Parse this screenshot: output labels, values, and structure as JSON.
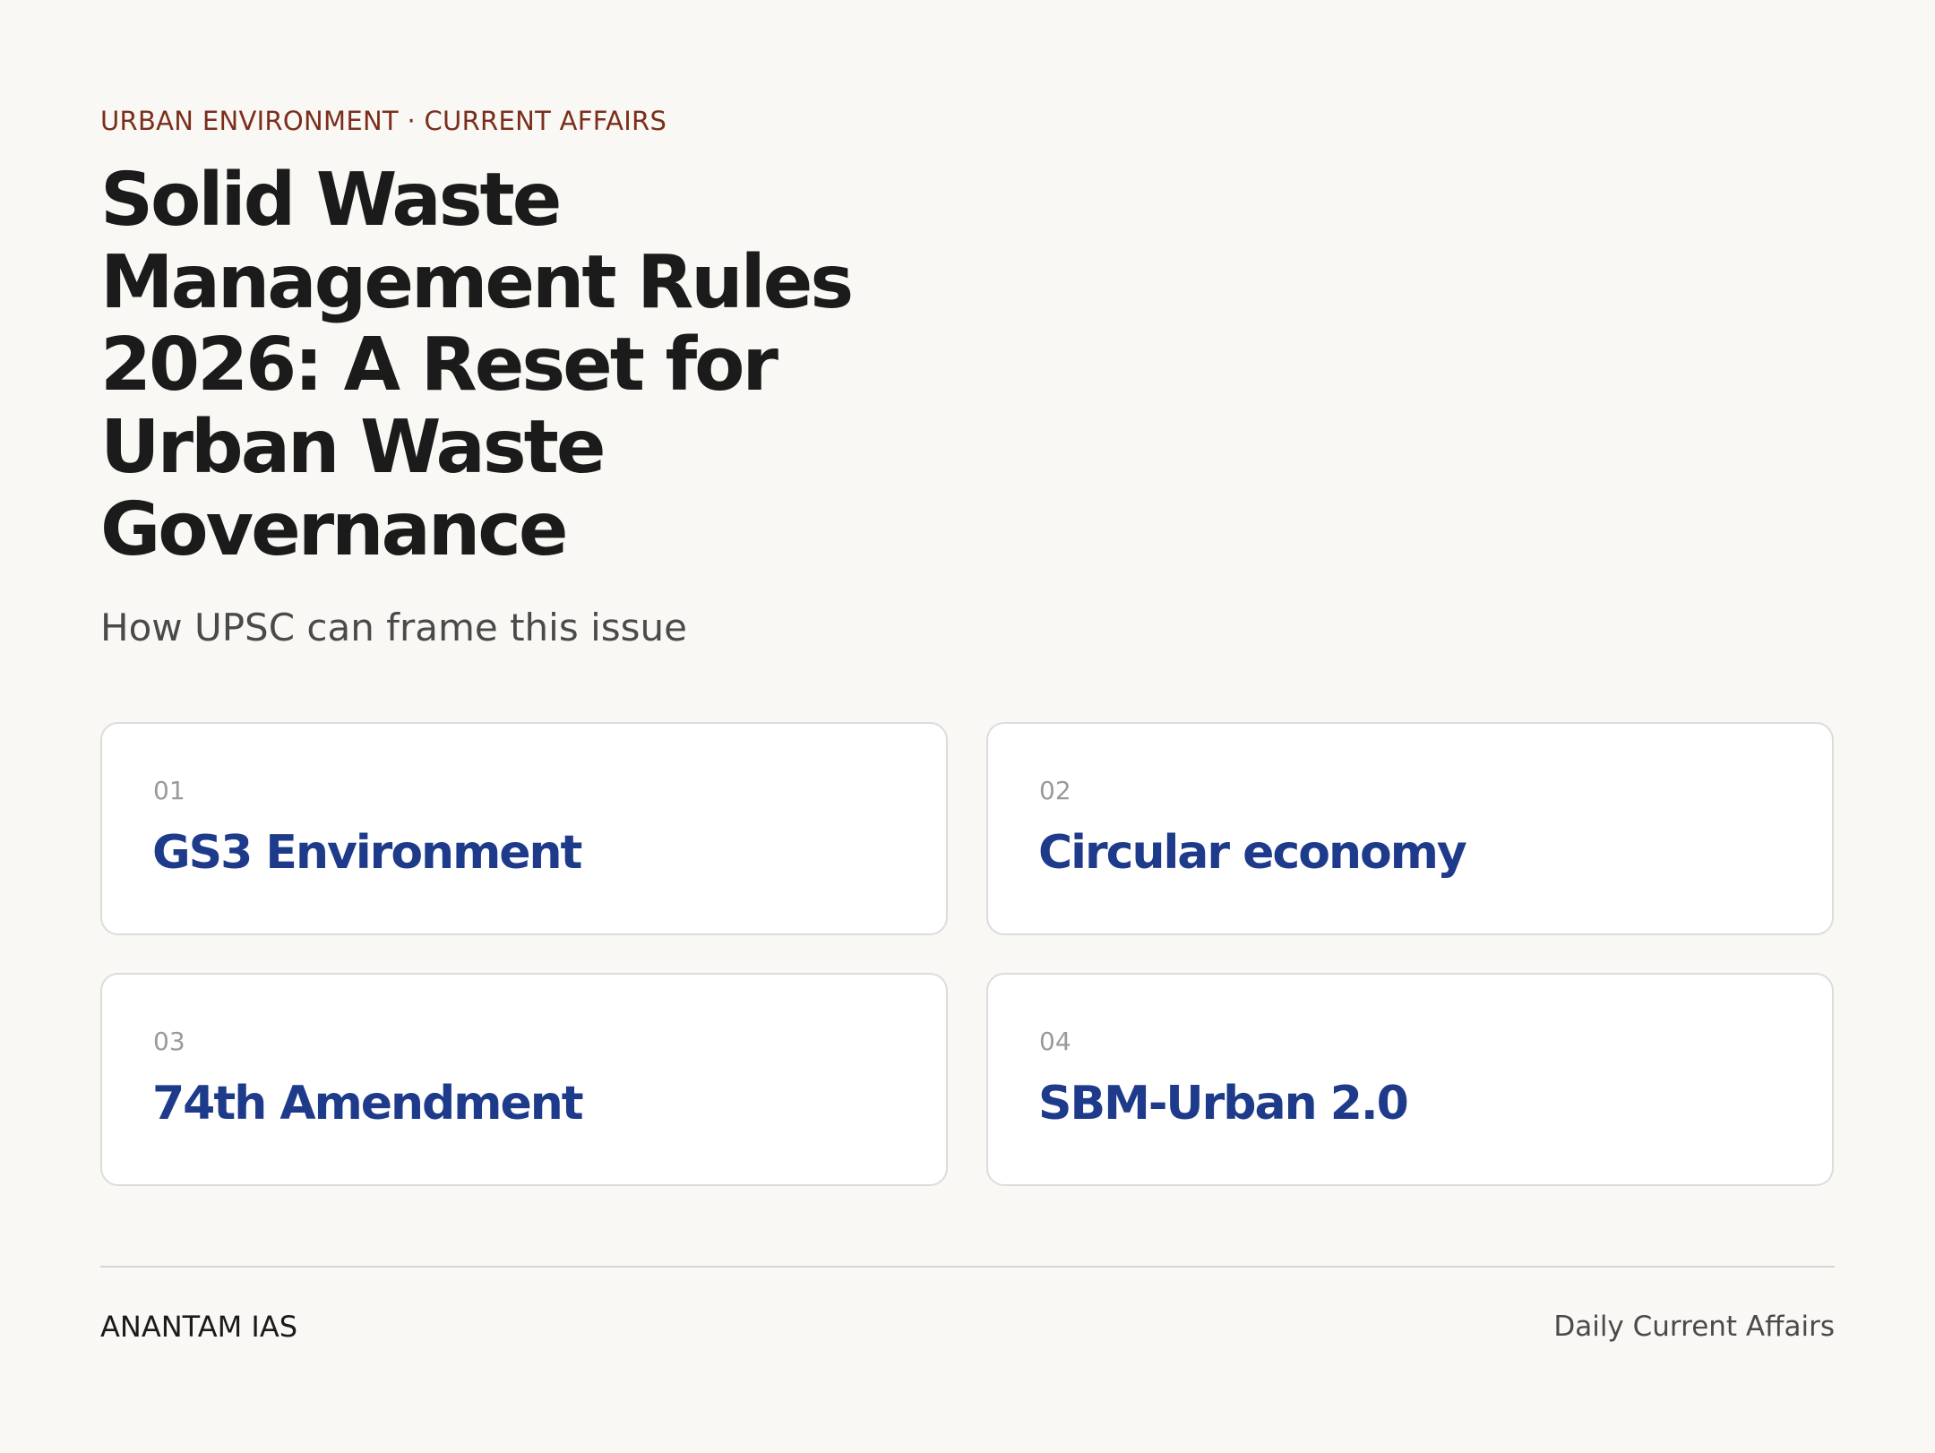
{
  "header": {
    "eyebrow": "URBAN ENVIRONMENT · CURRENT AFFAIRS",
    "title": "Solid Waste Management Rules 2026: A Reset for Urban Waste Governance",
    "subtitle": "How UPSC can frame this issue"
  },
  "cards": [
    {
      "number": "01",
      "label": "GS3 Environment"
    },
    {
      "number": "02",
      "label": "Circular economy"
    },
    {
      "number": "03",
      "label": "74th Amendment"
    },
    {
      "number": "04",
      "label": "SBM-Urban 2.0"
    }
  ],
  "footer": {
    "brand": "ANANTAM IAS",
    "tagline": "Daily Current Affairs"
  },
  "colors": {
    "background": "#f9f8f4",
    "eyebrow": "#7b2e1b",
    "title": "#1b1b1b",
    "card_label": "#1e3a8a",
    "card_border": "#dcdcdc"
  }
}
